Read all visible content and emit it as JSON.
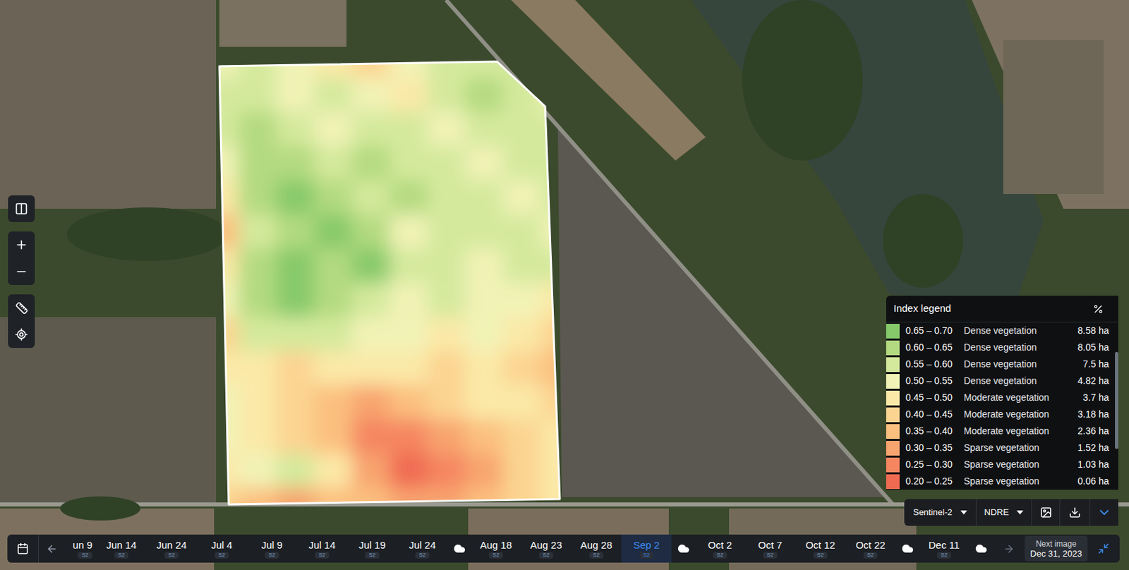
{
  "field": {
    "index_grid": [
      [
        0.53,
        0.58,
        0.53,
        0.48,
        0.43,
        0.53,
        0.58,
        0.58,
        0.58,
        0.58
      ],
      [
        0.58,
        0.58,
        0.53,
        0.58,
        0.53,
        0.48,
        0.58,
        0.63,
        0.58,
        0.53
      ],
      [
        0.58,
        0.63,
        0.58,
        0.53,
        0.58,
        0.58,
        0.53,
        0.58,
        0.58,
        0.58
      ],
      [
        0.53,
        0.63,
        0.63,
        0.58,
        0.63,
        0.58,
        0.58,
        0.53,
        0.58,
        0.58
      ],
      [
        0.48,
        0.63,
        0.68,
        0.63,
        0.58,
        0.63,
        0.58,
        0.58,
        0.53,
        0.58
      ],
      [
        0.38,
        0.58,
        0.63,
        0.68,
        0.63,
        0.53,
        0.58,
        0.58,
        0.58,
        0.53
      ],
      [
        0.48,
        0.63,
        0.68,
        0.63,
        0.68,
        0.58,
        0.58,
        0.53,
        0.58,
        0.58
      ],
      [
        0.53,
        0.63,
        0.68,
        0.63,
        0.58,
        0.53,
        0.58,
        0.53,
        0.53,
        0.48
      ],
      [
        0.43,
        0.58,
        0.58,
        0.58,
        0.53,
        0.53,
        0.48,
        0.53,
        0.48,
        0.43
      ],
      [
        0.48,
        0.48,
        0.43,
        0.48,
        0.48,
        0.48,
        0.43,
        0.48,
        0.43,
        0.38
      ],
      [
        0.53,
        0.48,
        0.43,
        0.38,
        0.33,
        0.38,
        0.43,
        0.48,
        0.48,
        0.43
      ],
      [
        0.53,
        0.48,
        0.43,
        0.38,
        0.28,
        0.28,
        0.33,
        0.38,
        0.43,
        0.48
      ],
      [
        0.48,
        0.53,
        0.58,
        0.48,
        0.33,
        0.23,
        0.28,
        0.33,
        0.43,
        0.48
      ],
      [
        0.43,
        0.38,
        0.33,
        0.38,
        0.38,
        0.33,
        0.33,
        0.38,
        0.43,
        0.48
      ]
    ]
  },
  "legend": {
    "title": "Index legend",
    "scroll_level": 0.6,
    "rows": [
      {
        "range": "0.65 – 0.70",
        "label": "Dense vegetation",
        "area": "8.58 ha",
        "color": "#86c96b"
      },
      {
        "range": "0.60 – 0.65",
        "label": "Dense vegetation",
        "area": "8.05 ha",
        "color": "#b3da80"
      },
      {
        "range": "0.55 – 0.60",
        "label": "Dense vegetation",
        "area": "7.5 ha",
        "color": "#d4e99c"
      },
      {
        "range": "0.50 – 0.55",
        "label": "Dense vegetation",
        "area": "4.82 ha",
        "color": "#f1f3b6"
      },
      {
        "range": "0.45 – 0.50",
        "label": "Moderate vegetation",
        "area": "3.7 ha",
        "color": "#fbe9a8"
      },
      {
        "range": "0.40 – 0.45",
        "label": "Moderate vegetation",
        "area": "3.18 ha",
        "color": "#fcd491"
      },
      {
        "range": "0.35 – 0.40",
        "label": "Moderate vegetation",
        "area": "2.36 ha",
        "color": "#fbbf7e"
      },
      {
        "range": "0.30 – 0.35",
        "label": "Sparse vegetation",
        "area": "1.52 ha",
        "color": "#f8a46e"
      },
      {
        "range": "0.25 – 0.30",
        "label": "Sparse vegetation",
        "area": "1.03 ha",
        "color": "#f58660"
      },
      {
        "range": "0.20 – 0.25",
        "label": "Sparse vegetation",
        "area": "0.06 ha",
        "color": "#f06a52"
      }
    ]
  },
  "source": {
    "satellite": "Sentinel-2",
    "index": "NDRE"
  },
  "timeline": {
    "items": [
      {
        "kind": "date",
        "label": "un 9",
        "badge": "S2",
        "selected": false
      },
      {
        "kind": "date",
        "label": "Jun 14",
        "badge": "S2",
        "selected": false
      },
      {
        "kind": "date",
        "label": "Jun 24",
        "badge": "S2",
        "selected": false
      },
      {
        "kind": "date",
        "label": "Jul 4",
        "badge": "S2",
        "selected": false
      },
      {
        "kind": "date",
        "label": "Jul 9",
        "badge": "S2",
        "selected": false
      },
      {
        "kind": "date",
        "label": "Jul 14",
        "badge": "S2",
        "selected": false
      },
      {
        "kind": "date",
        "label": "Jul 19",
        "badge": "S2",
        "selected": false
      },
      {
        "kind": "date",
        "label": "Jul 24",
        "badge": "S2",
        "selected": false
      },
      {
        "kind": "cloud",
        "selected": false
      },
      {
        "kind": "date",
        "label": "Aug 18",
        "badge": "S2",
        "selected": false
      },
      {
        "kind": "date",
        "label": "Aug 23",
        "badge": "S2",
        "selected": false
      },
      {
        "kind": "date",
        "label": "Aug 28",
        "badge": "S2",
        "selected": false
      },
      {
        "kind": "date",
        "label": "Sep 2",
        "badge": "S2",
        "selected": true
      },
      {
        "kind": "cloud",
        "selected": false
      },
      {
        "kind": "date",
        "label": "Oct 2",
        "badge": "S2",
        "selected": false
      },
      {
        "kind": "date",
        "label": "Oct 7",
        "badge": "S2",
        "selected": false
      },
      {
        "kind": "date",
        "label": "Oct 12",
        "badge": "S2",
        "selected": false
      },
      {
        "kind": "date",
        "label": "Oct 22",
        "badge": "S2",
        "selected": false
      },
      {
        "kind": "cloud",
        "selected": false
      },
      {
        "kind": "date",
        "label": "Dec 11",
        "badge": "S2",
        "selected": false
      },
      {
        "kind": "cloud",
        "selected": false
      }
    ],
    "next": {
      "label": "Next image",
      "date": "Dec 31, 2023"
    }
  }
}
